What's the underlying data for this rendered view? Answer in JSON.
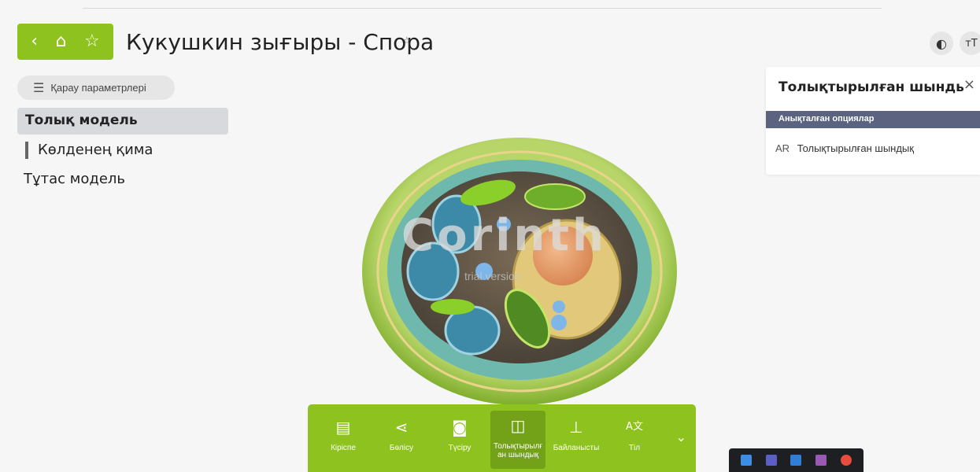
{
  "header": {
    "back_icon": "‹",
    "home_icon": "⌂",
    "favorite_icon": "☆",
    "title": "Кукушкин зығыры - Спора",
    "title_star_icon": "☆",
    "right_icons": [
      "contrast-icon",
      "text-size-icon"
    ],
    "right_glyphs": [
      "◐",
      "ᴛT"
    ]
  },
  "sidebar": {
    "view_params_label": "Қарау параметрлері",
    "items": [
      {
        "label": "Толық модель",
        "active": true
      },
      {
        "label": "Көлденең қима",
        "active": false
      },
      {
        "label": "Тұтас модель",
        "active": false
      }
    ]
  },
  "viewer": {
    "watermark": "Corinth",
    "watermark_sub": "trial version"
  },
  "ar_panel": {
    "title": "Толықтырылған шындық",
    "close_icon": "×",
    "section_header": "Анықталған опциялар",
    "option_tag": "AR",
    "option_label": "Толықтырылған шындық"
  },
  "toolbar": {
    "items": [
      {
        "label": "Кіріспе",
        "icon": "book-icon",
        "glyph": "▤"
      },
      {
        "label": "Бөлісу",
        "icon": "share-icon",
        "glyph": "⋖"
      },
      {
        "label": "Түсіру",
        "icon": "camera-icon",
        "glyph": "◙"
      },
      {
        "label": "Толықтырылған шындық",
        "icon": "ar-glasses-icon",
        "glyph": "◫"
      },
      {
        "label": "Байланысты",
        "icon": "hierarchy-icon",
        "glyph": "⊥"
      },
      {
        "label": "Тіл",
        "icon": "language-icon",
        "glyph": "A文"
      }
    ],
    "active_index": 3,
    "more_icon": "⌄"
  },
  "taskbar": {
    "colors": [
      "#3a8ee6",
      "#5b5fc7",
      "#2f7fd8",
      "#9b59b6",
      "#e74c3c"
    ]
  },
  "colors": {
    "accent": "#8dc21f",
    "panel_band": "#5b6381"
  }
}
